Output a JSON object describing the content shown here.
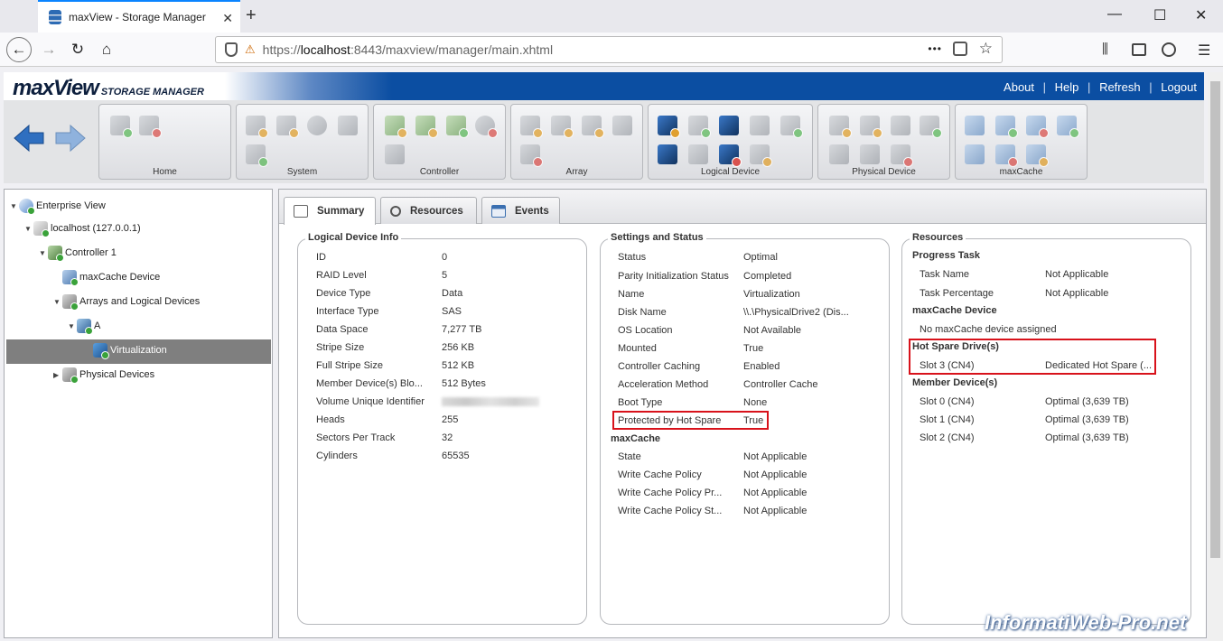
{
  "browser": {
    "tab_title": "maxView - Storage Manager",
    "url_scheme": "https://",
    "url_host": "localhost",
    "url_rest": ":8443/maxview/manager/main.xhtml",
    "new_tab": "+",
    "tab_close": "✕",
    "win_minimize": "—",
    "win_maximize": "☐",
    "win_close": "✕",
    "back": "←",
    "forward": "→",
    "reload": "↻",
    "home": "⌂",
    "more": "•••",
    "menu": "☰"
  },
  "app": {
    "logo_main": "maxView",
    "logo_sub": "STORAGE MANAGER",
    "links": [
      "About",
      "Help",
      "Refresh",
      "Logout"
    ],
    "link_sep": "|"
  },
  "ribbon": {
    "groups": [
      "Home",
      "System",
      "Controller",
      "Array",
      "Logical Device",
      "Physical Device",
      "maxCache"
    ]
  },
  "tree": {
    "nodes": [
      "Enterprise View",
      "localhost (127.0.0.1)",
      "Controller 1",
      "maxCache Device",
      "Arrays and Logical Devices",
      "A",
      "Virtualization",
      "Physical Devices"
    ]
  },
  "tabs": [
    "Summary",
    "Resources",
    "Events"
  ],
  "logical_device_info": {
    "legend": "Logical Device Info",
    "rows": [
      {
        "label": "ID",
        "value": "0"
      },
      {
        "label": "RAID Level",
        "value": "5"
      },
      {
        "label": "Device Type",
        "value": "Data"
      },
      {
        "label": "Interface Type",
        "value": "SAS"
      },
      {
        "label": "Data Space",
        "value": "7,277 TB"
      },
      {
        "label": "Stripe Size",
        "value": "256 KB"
      },
      {
        "label": "Full Stripe Size",
        "value": "512 KB"
      },
      {
        "label": "Member Device(s) Blo...",
        "value": "512 Bytes"
      },
      {
        "label": "Volume Unique Identifier",
        "value": ""
      },
      {
        "label": "Heads",
        "value": "255"
      },
      {
        "label": "Sectors Per Track",
        "value": "32"
      },
      {
        "label": "Cylinders",
        "value": "65535"
      }
    ]
  },
  "settings_status": {
    "legend": "Settings and Status",
    "rows": [
      {
        "label": "Status",
        "value": "Optimal"
      },
      {
        "label": "Parity Initialization Status",
        "value": "Completed"
      },
      {
        "label": "Name",
        "value": "Virtualization"
      },
      {
        "label": "Disk Name",
        "value": "\\\\.\\PhysicalDrive2 (Dis..."
      },
      {
        "label": "OS Location",
        "value": "Not Available"
      },
      {
        "label": "Mounted",
        "value": "True"
      },
      {
        "label": "Controller Caching",
        "value": "Enabled"
      },
      {
        "label": "Acceleration Method",
        "value": "Controller Cache"
      },
      {
        "label": "Boot Type",
        "value": "None"
      },
      {
        "label": "Protected by Hot Spare",
        "value": "True"
      }
    ],
    "maxcache_title": "maxCache",
    "maxcache_rows": [
      {
        "label": "State",
        "value": "Not Applicable"
      },
      {
        "label": "Write Cache Policy",
        "value": "Not Applicable"
      },
      {
        "label": "Write Cache Policy Pr...",
        "value": "Not Applicable"
      },
      {
        "label": "Write Cache Policy St...",
        "value": "Not Applicable"
      }
    ]
  },
  "resources": {
    "legend": "Resources",
    "progress_title": "Progress Task",
    "progress_rows": [
      {
        "label": "Task Name",
        "value": "Not Applicable"
      },
      {
        "label": "Task Percentage",
        "value": "Not Applicable"
      }
    ],
    "maxcache_title": "maxCache Device",
    "maxcache_text": "No maxCache device assigned",
    "hotspare_title": "Hot Spare Drive(s)",
    "hotspare_rows": [
      {
        "label": "Slot 3 (CN4)",
        "value": "Dedicated Hot Spare (..."
      }
    ],
    "member_title": "Member Device(s)",
    "member_rows": [
      {
        "label": "Slot 0 (CN4)",
        "value": "Optimal (3,639 TB)"
      },
      {
        "label": "Slot 1 (CN4)",
        "value": "Optimal (3,639 TB)"
      },
      {
        "label": "Slot 2 (CN4)",
        "value": "Optimal (3,639 TB)"
      }
    ]
  },
  "watermark": "InformatiWeb-Pro.net",
  "colors": {
    "header_blue": "#0b4ea2",
    "highlight_red": "#d8121b",
    "tree_selected": "#7f7f7f",
    "ok_green": "#3aa23a"
  }
}
